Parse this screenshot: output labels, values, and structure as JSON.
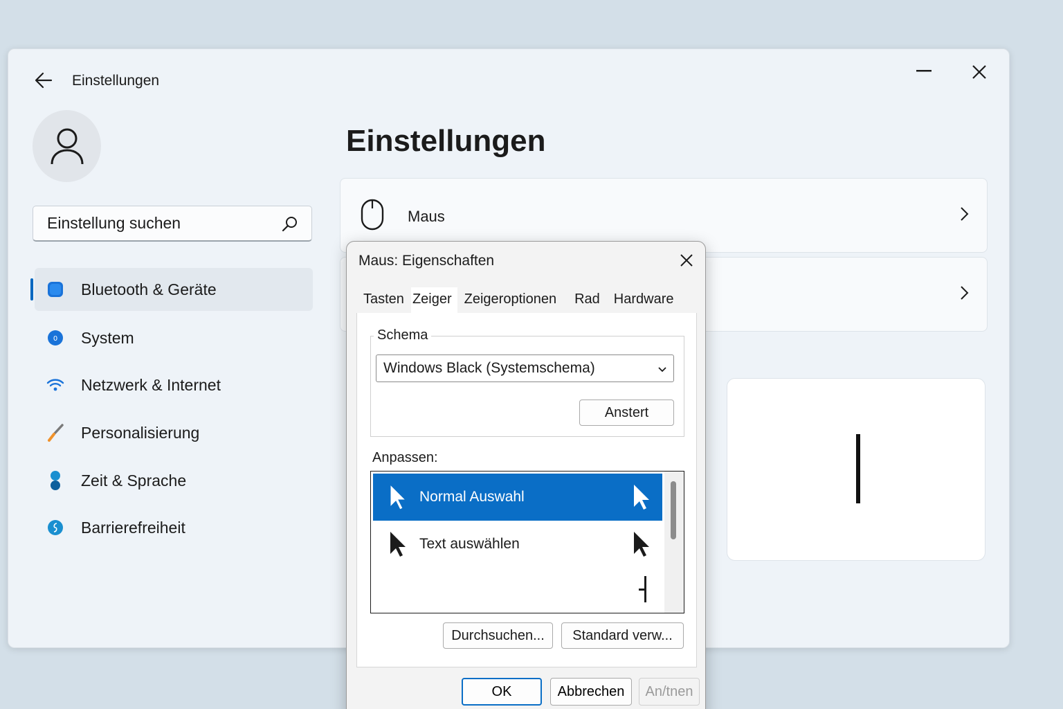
{
  "window": {
    "title": "Einstellungen",
    "page_title": "Einstellungen",
    "search_placeholder": "Einstellung suchen"
  },
  "sidebar": {
    "items": [
      {
        "label": "Bluetooth & Geräte",
        "icon": "bluetooth-devices-icon",
        "active": true
      },
      {
        "label": "System",
        "icon": "system-icon"
      },
      {
        "label": "Netzwerk & Internet",
        "icon": "wifi-icon"
      },
      {
        "label": "Personalisierung",
        "icon": "brush-icon"
      },
      {
        "label": "Zeit & Sprache",
        "icon": "time-language-icon"
      },
      {
        "label": "Barrierefreiheit",
        "icon": "accessibility-icon"
      }
    ]
  },
  "cards": {
    "mouse_label": "Maus"
  },
  "dialog": {
    "title": "Maus: Eigenschaften",
    "tabs": [
      "Tasten",
      "Zeiger",
      "Zeigeroptionen",
      "Rad",
      "Hardware"
    ],
    "schema_label": "Schema",
    "schema_value_bold": "Windows Black",
    "schema_value_rest": " (Systemschema)",
    "schema_button": "Anstert",
    "customize_label": "Anpassen:",
    "list": [
      {
        "label": "Normal Auswahl",
        "selected": true
      },
      {
        "label": "Text auswählen",
        "selected": false
      }
    ],
    "browse_button": "Durchsuchen...",
    "default_button": "Standard verw...",
    "ok_button": "OK",
    "cancel_button": "Abbrechen",
    "apply_button": "An/tnen"
  },
  "colors": {
    "accent": "#0067c0",
    "selection": "#0a6ec6",
    "background": "#d3dfe8"
  }
}
